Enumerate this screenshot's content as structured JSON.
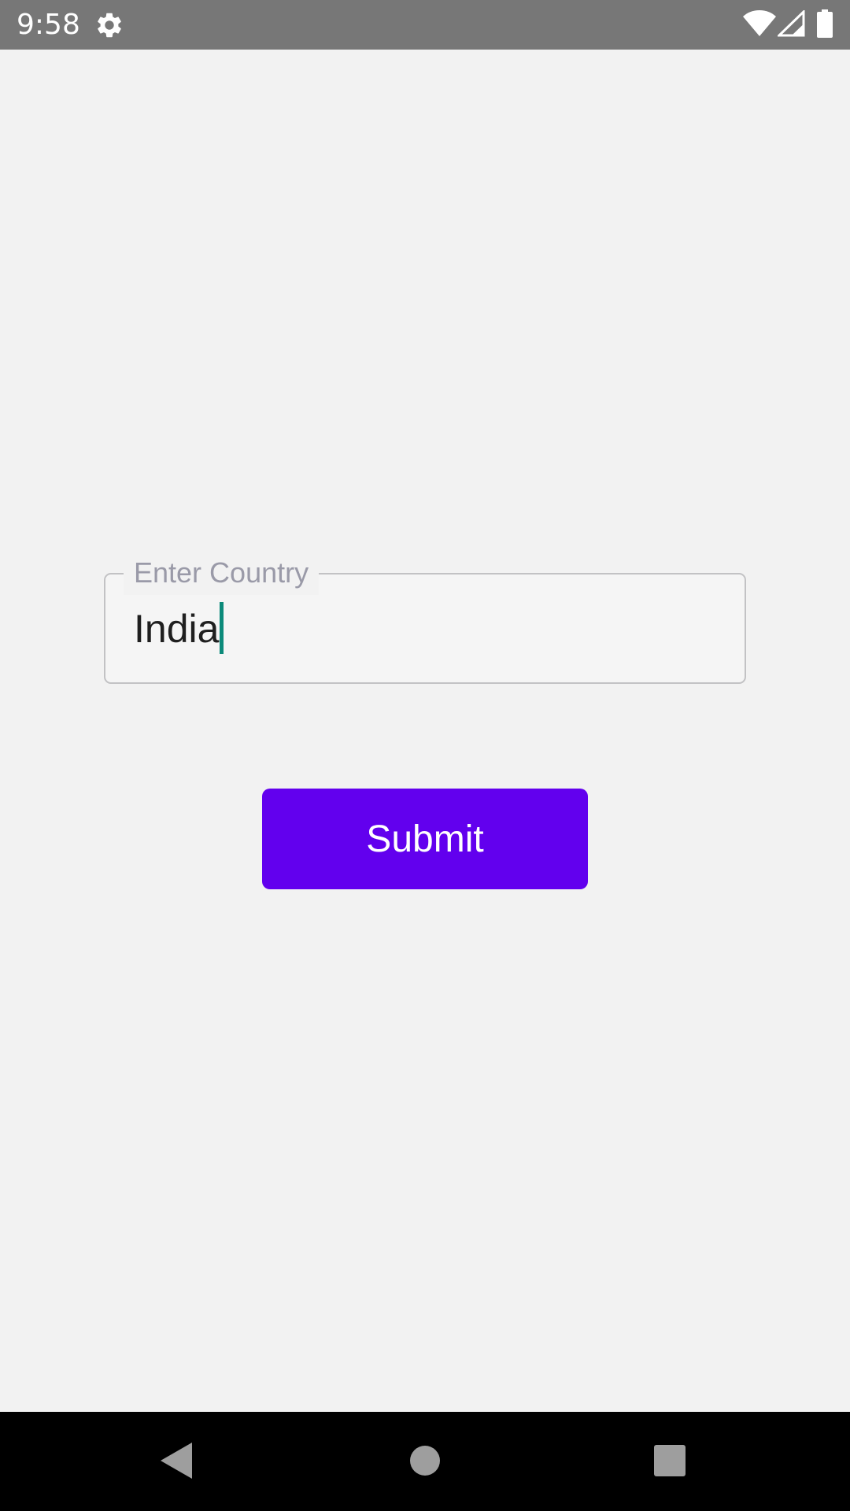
{
  "status_bar": {
    "time": "9:58",
    "icons": [
      "gear-icon",
      "wifi-icon",
      "cell-signal-icon",
      "battery-icon"
    ]
  },
  "form": {
    "country_label": "Enter Country",
    "country_value": "India",
    "submit_label": "Submit"
  },
  "navigation": {
    "icons": [
      "back-icon",
      "home-icon",
      "recents-icon"
    ]
  },
  "colors": {
    "status_bar": "#777777",
    "background": "#f2f2f2",
    "accent": "#6200ee",
    "cursor": "#0c8a7a",
    "nav_bar": "#000000"
  }
}
